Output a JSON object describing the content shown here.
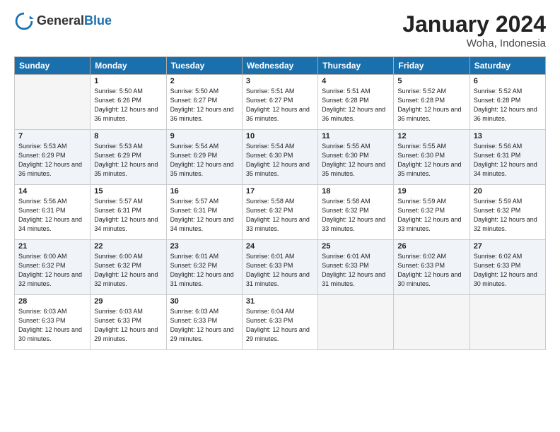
{
  "logo": {
    "general": "General",
    "blue": "Blue"
  },
  "header": {
    "title": "January 2024",
    "subtitle": "Woha, Indonesia"
  },
  "columns": [
    "Sunday",
    "Monday",
    "Tuesday",
    "Wednesday",
    "Thursday",
    "Friday",
    "Saturday"
  ],
  "weeks": [
    [
      {
        "day": "",
        "empty": true
      },
      {
        "day": "1",
        "sunrise": "5:50 AM",
        "sunset": "6:26 PM",
        "daylight": "12 hours and 36 minutes."
      },
      {
        "day": "2",
        "sunrise": "5:50 AM",
        "sunset": "6:27 PM",
        "daylight": "12 hours and 36 minutes."
      },
      {
        "day": "3",
        "sunrise": "5:51 AM",
        "sunset": "6:27 PM",
        "daylight": "12 hours and 36 minutes."
      },
      {
        "day": "4",
        "sunrise": "5:51 AM",
        "sunset": "6:28 PM",
        "daylight": "12 hours and 36 minutes."
      },
      {
        "day": "5",
        "sunrise": "5:52 AM",
        "sunset": "6:28 PM",
        "daylight": "12 hours and 36 minutes."
      },
      {
        "day": "6",
        "sunrise": "5:52 AM",
        "sunset": "6:28 PM",
        "daylight": "12 hours and 36 minutes."
      }
    ],
    [
      {
        "day": "7",
        "sunrise": "5:53 AM",
        "sunset": "6:29 PM",
        "daylight": "12 hours and 36 minutes."
      },
      {
        "day": "8",
        "sunrise": "5:53 AM",
        "sunset": "6:29 PM",
        "daylight": "12 hours and 35 minutes."
      },
      {
        "day": "9",
        "sunrise": "5:54 AM",
        "sunset": "6:29 PM",
        "daylight": "12 hours and 35 minutes."
      },
      {
        "day": "10",
        "sunrise": "5:54 AM",
        "sunset": "6:30 PM",
        "daylight": "12 hours and 35 minutes."
      },
      {
        "day": "11",
        "sunrise": "5:55 AM",
        "sunset": "6:30 PM",
        "daylight": "12 hours and 35 minutes."
      },
      {
        "day": "12",
        "sunrise": "5:55 AM",
        "sunset": "6:30 PM",
        "daylight": "12 hours and 35 minutes."
      },
      {
        "day": "13",
        "sunrise": "5:56 AM",
        "sunset": "6:31 PM",
        "daylight": "12 hours and 34 minutes."
      }
    ],
    [
      {
        "day": "14",
        "sunrise": "5:56 AM",
        "sunset": "6:31 PM",
        "daylight": "12 hours and 34 minutes."
      },
      {
        "day": "15",
        "sunrise": "5:57 AM",
        "sunset": "6:31 PM",
        "daylight": "12 hours and 34 minutes."
      },
      {
        "day": "16",
        "sunrise": "5:57 AM",
        "sunset": "6:31 PM",
        "daylight": "12 hours and 34 minutes."
      },
      {
        "day": "17",
        "sunrise": "5:58 AM",
        "sunset": "6:32 PM",
        "daylight": "12 hours and 33 minutes."
      },
      {
        "day": "18",
        "sunrise": "5:58 AM",
        "sunset": "6:32 PM",
        "daylight": "12 hours and 33 minutes."
      },
      {
        "day": "19",
        "sunrise": "5:59 AM",
        "sunset": "6:32 PM",
        "daylight": "12 hours and 33 minutes."
      },
      {
        "day": "20",
        "sunrise": "5:59 AM",
        "sunset": "6:32 PM",
        "daylight": "12 hours and 32 minutes."
      }
    ],
    [
      {
        "day": "21",
        "sunrise": "6:00 AM",
        "sunset": "6:32 PM",
        "daylight": "12 hours and 32 minutes."
      },
      {
        "day": "22",
        "sunrise": "6:00 AM",
        "sunset": "6:32 PM",
        "daylight": "12 hours and 32 minutes."
      },
      {
        "day": "23",
        "sunrise": "6:01 AM",
        "sunset": "6:32 PM",
        "daylight": "12 hours and 31 minutes."
      },
      {
        "day": "24",
        "sunrise": "6:01 AM",
        "sunset": "6:33 PM",
        "daylight": "12 hours and 31 minutes."
      },
      {
        "day": "25",
        "sunrise": "6:01 AM",
        "sunset": "6:33 PM",
        "daylight": "12 hours and 31 minutes."
      },
      {
        "day": "26",
        "sunrise": "6:02 AM",
        "sunset": "6:33 PM",
        "daylight": "12 hours and 30 minutes."
      },
      {
        "day": "27",
        "sunrise": "6:02 AM",
        "sunset": "6:33 PM",
        "daylight": "12 hours and 30 minutes."
      }
    ],
    [
      {
        "day": "28",
        "sunrise": "6:03 AM",
        "sunset": "6:33 PM",
        "daylight": "12 hours and 30 minutes."
      },
      {
        "day": "29",
        "sunrise": "6:03 AM",
        "sunset": "6:33 PM",
        "daylight": "12 hours and 29 minutes."
      },
      {
        "day": "30",
        "sunrise": "6:03 AM",
        "sunset": "6:33 PM",
        "daylight": "12 hours and 29 minutes."
      },
      {
        "day": "31",
        "sunrise": "6:04 AM",
        "sunset": "6:33 PM",
        "daylight": "12 hours and 29 minutes."
      },
      {
        "day": "",
        "empty": true
      },
      {
        "day": "",
        "empty": true
      },
      {
        "day": "",
        "empty": true
      }
    ]
  ]
}
